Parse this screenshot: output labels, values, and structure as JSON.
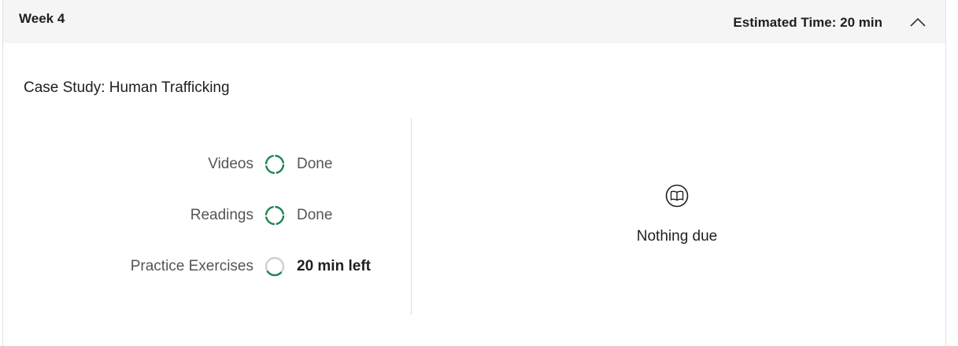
{
  "week": {
    "title": "Week 4",
    "estimated_time": "Estimated Time: 20 min",
    "collapse_icon": "chevron-up-icon"
  },
  "module": {
    "title": "Case Study: Human Trafficking",
    "items": [
      {
        "label": "Videos",
        "status": "Done",
        "progress": 1.0
      },
      {
        "label": "Readings",
        "status": "Done",
        "progress": 1.0
      },
      {
        "label": "Practice Exercises",
        "status": "20 min left",
        "progress": 0.3
      }
    ],
    "accent_color": "#1f8354",
    "due": {
      "icon": "book-icon",
      "text": "Nothing due"
    }
  }
}
